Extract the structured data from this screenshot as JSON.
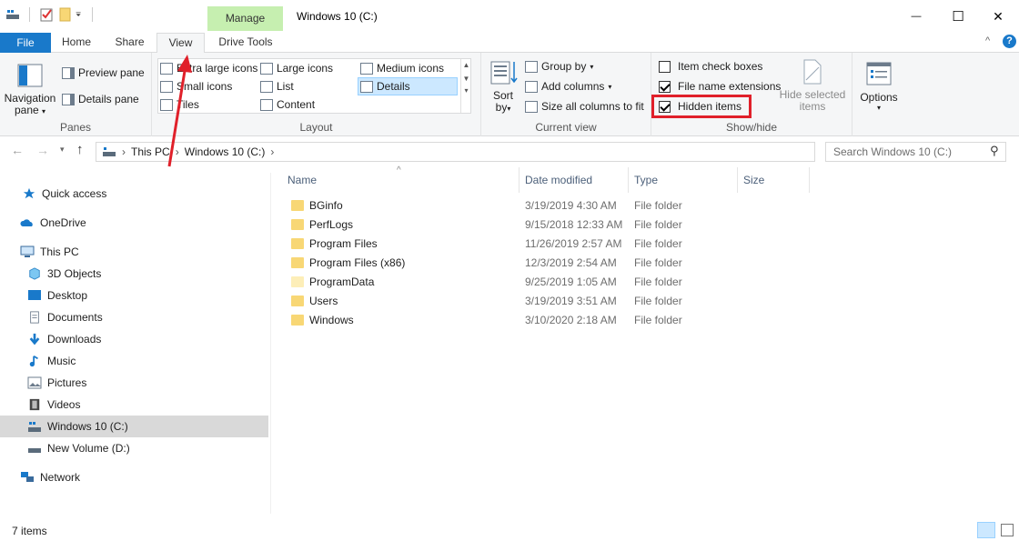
{
  "window": {
    "title": "Windows 10 (C:)",
    "contextual_tab_header": "Manage",
    "minimize_glyph": "—",
    "maximize_glyph": "☐",
    "close_glyph": "✕"
  },
  "tabs": [
    {
      "label": "File"
    },
    {
      "label": "Home"
    },
    {
      "label": "Share"
    },
    {
      "label": "View"
    },
    {
      "label": "Drive Tools"
    }
  ],
  "ribbon": {
    "panes": {
      "label": "Panes",
      "navigation_pane": "Navigation pane",
      "navigation_pane_line1": "Navigation",
      "navigation_pane_line2": "pane",
      "preview_pane": "Preview pane",
      "details_pane": "Details pane"
    },
    "layout": {
      "label": "Layout",
      "options": [
        "Extra large icons",
        "Large icons",
        "Medium icons",
        "Small icons",
        "List",
        "Details",
        "Tiles",
        "Content"
      ],
      "selected": "Details"
    },
    "current_view": {
      "label": "Current view",
      "sort_by": "Sort by",
      "sort_line1": "Sort",
      "sort_line2": "by",
      "group_by": "Group by",
      "add_columns": "Add columns",
      "size_all_columns": "Size all columns to fit"
    },
    "show_hide": {
      "label": "Show/hide",
      "item_check_boxes": {
        "label": "Item check boxes",
        "checked": false
      },
      "file_name_extensions": {
        "label": "File name extensions",
        "checked": true
      },
      "hidden_items": {
        "label": "Hidden items",
        "checked": true
      },
      "hide_selected_line1": "Hide selected",
      "hide_selected_line2": "items"
    },
    "options": {
      "label": "Options"
    }
  },
  "address": {
    "crumbs": [
      "This PC",
      "Windows 10 (C:)"
    ],
    "search_placeholder": "Search Windows 10 (C:)"
  },
  "nav": [
    {
      "label": "Quick access",
      "icon": "star-icon"
    },
    {
      "label": "OneDrive",
      "icon": "cloud-icon"
    },
    {
      "label": "This PC",
      "icon": "computer-icon"
    },
    {
      "label": "3D Objects",
      "icon": "cube-icon"
    },
    {
      "label": "Desktop",
      "icon": "desktop-icon"
    },
    {
      "label": "Documents",
      "icon": "document-icon"
    },
    {
      "label": "Downloads",
      "icon": "download-icon"
    },
    {
      "label": "Music",
      "icon": "music-note-icon"
    },
    {
      "label": "Pictures",
      "icon": "picture-icon"
    },
    {
      "label": "Videos",
      "icon": "film-icon"
    },
    {
      "label": "Windows 10 (C:)",
      "icon": "drive-icon"
    },
    {
      "label": "New Volume (D:)",
      "icon": "drive-icon"
    },
    {
      "label": "Network",
      "icon": "network-icon"
    }
  ],
  "columns": {
    "name": "Name",
    "date": "Date modified",
    "type": "Type",
    "size": "Size"
  },
  "files": [
    {
      "name": "BGinfo",
      "date": "3/19/2019 4:30 AM",
      "type": "File folder"
    },
    {
      "name": "PerfLogs",
      "date": "9/15/2018 12:33 AM",
      "type": "File folder"
    },
    {
      "name": "Program Files",
      "date": "11/26/2019 2:57 AM",
      "type": "File folder"
    },
    {
      "name": "Program Files (x86)",
      "date": "12/3/2019 2:54 AM",
      "type": "File folder"
    },
    {
      "name": "ProgramData",
      "date": "9/25/2019 1:05 AM",
      "type": "File folder"
    },
    {
      "name": "Users",
      "date": "3/19/2019 3:51 AM",
      "type": "File folder"
    },
    {
      "name": "Windows",
      "date": "3/10/2020 2:18 AM",
      "type": "File folder"
    }
  ],
  "status": {
    "item_count": "7 items"
  },
  "colors": {
    "file_tab": "#1979ca",
    "manage_header": "#c6efb0",
    "highlight_box": "#e0202a",
    "arrow": "#e0202a",
    "selected_nav": "#d9d9d9"
  }
}
